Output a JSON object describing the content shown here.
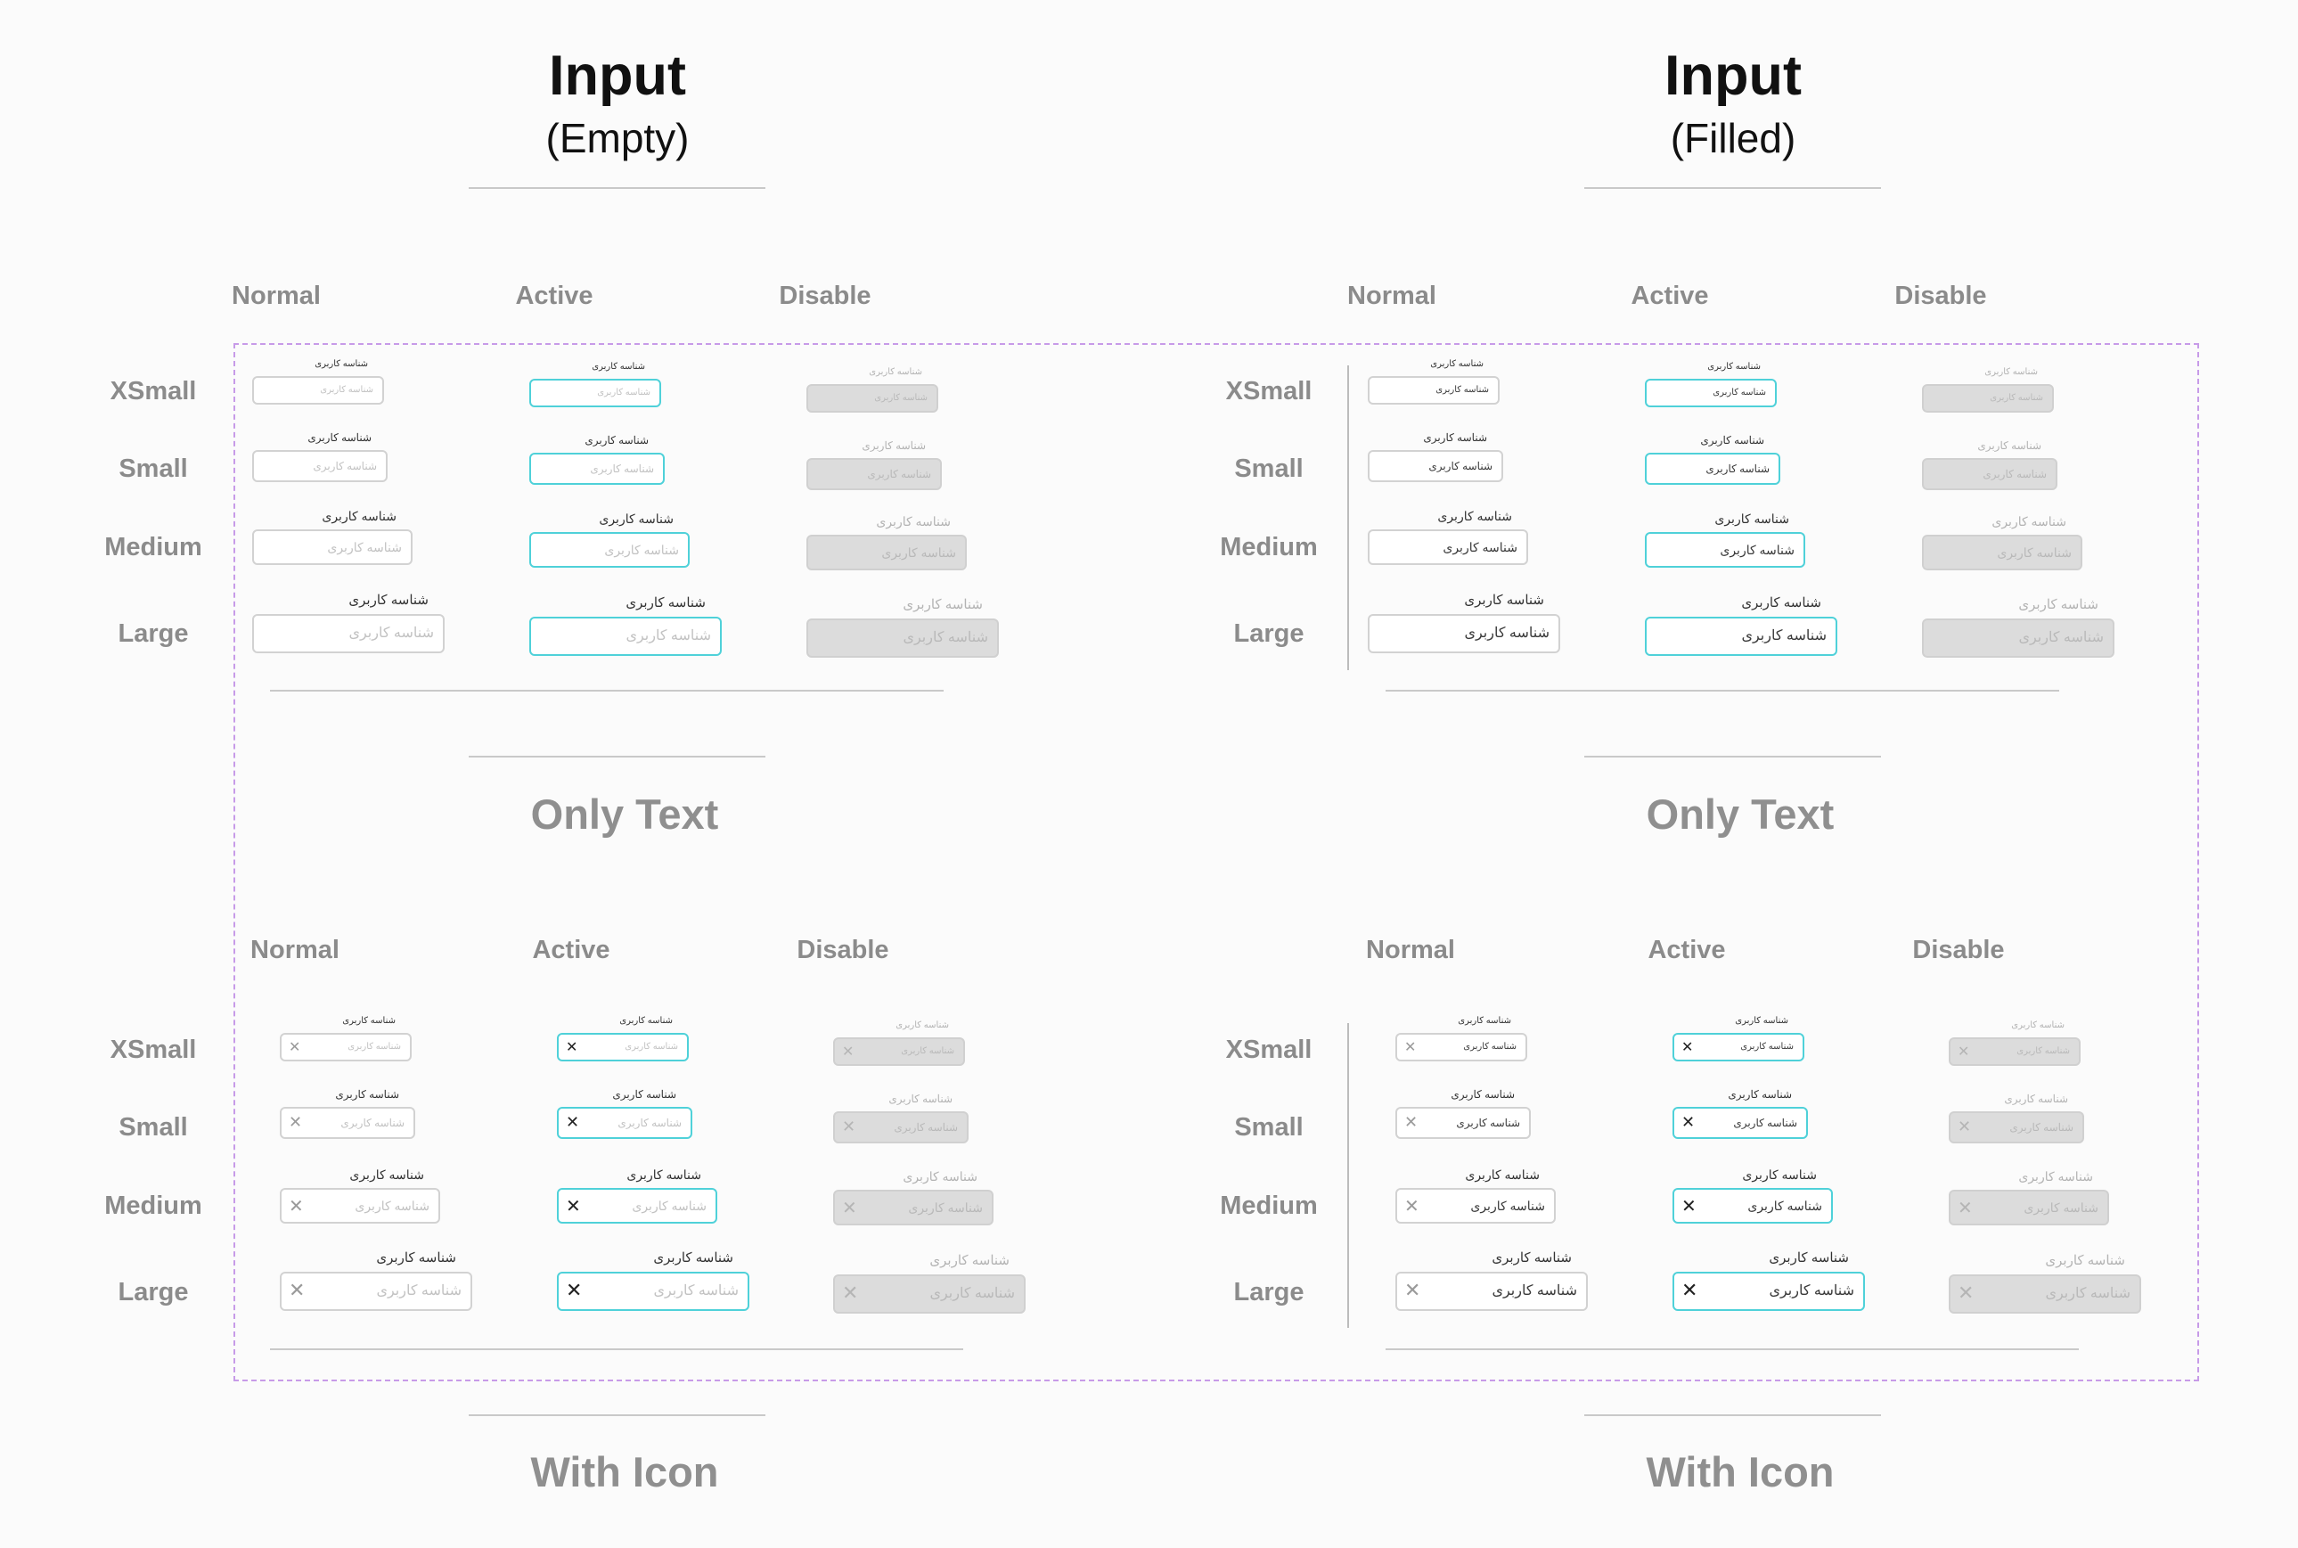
{
  "headings": {
    "empty": {
      "title": "Input",
      "subtitle": "(Empty)"
    },
    "filled": {
      "title": "Input",
      "subtitle": "(Filled)"
    }
  },
  "sections": {
    "only_text": "Only Text",
    "with_icon": "With Icon"
  },
  "states": {
    "normal": "Normal",
    "active": "Active",
    "disabled": "Disable"
  },
  "sizes": {
    "xsmall": "XSmall",
    "small": "Small",
    "medium": "Medium",
    "large": "Large"
  },
  "field": {
    "label": "شناسه کاربری",
    "placeholder": "شناسه کاربری",
    "value": "شناسه کاربری"
  },
  "icons": {
    "clear": "close-icon"
  },
  "colors": {
    "active_border": "#4fd1d9",
    "disabled_fill": "#dcdcdc",
    "frame_dash": "#c79be8",
    "muted_text": "#8b8b8b"
  }
}
